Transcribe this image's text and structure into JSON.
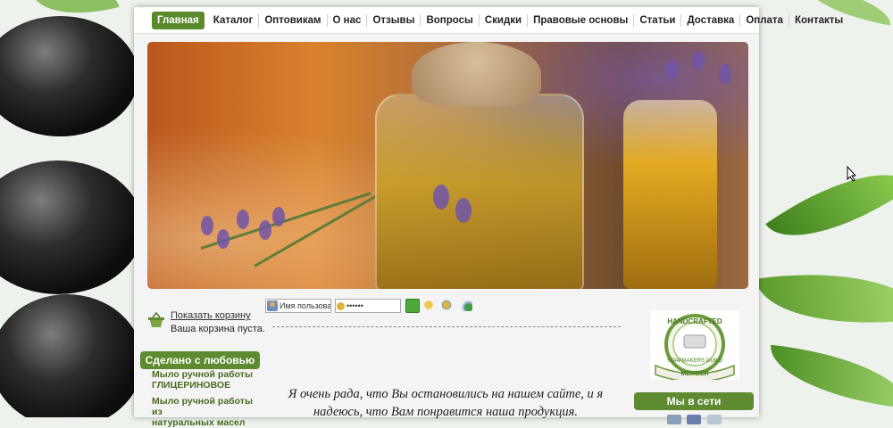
{
  "nav": {
    "items": [
      {
        "label": "Главная",
        "active": true
      },
      {
        "label": "Каталог"
      },
      {
        "label": "Оптовикам"
      },
      {
        "label": "О нас"
      },
      {
        "label": "Отзывы"
      },
      {
        "label": "Вопросы"
      },
      {
        "label": "Скидки"
      },
      {
        "label": "Правовые основы"
      },
      {
        "label": "Статьи"
      },
      {
        "label": "Доставка"
      },
      {
        "label": "Оплата"
      },
      {
        "label": "Контакты"
      }
    ],
    "accent_color": "#5b8a2c"
  },
  "cart": {
    "link": "Показать корзину",
    "status": "Ваша корзина пуста."
  },
  "sidebar": {
    "heading": "Сделано с любовью",
    "links": [
      {
        "line1": "Мыло ручной работы",
        "line2": "ГЛИЦЕРИНОВОЕ"
      },
      {
        "line1": "Мыло ручной работы из",
        "line2": "натуральных масел"
      }
    ]
  },
  "login": {
    "username_placeholder": "Имя пользователя",
    "password_value": "••••••"
  },
  "welcome": {
    "text": "Я очень  рада, что Вы остановились на нашем сайте, и я надеюсь, что Вам понравится наша продукция."
  },
  "badge": {
    "top_text": "HANDCRAFTED",
    "arc_text": "SOAPMAKERS GUILD",
    "ribbon_text": "MEMBER"
  },
  "social": {
    "heading": "Мы в сети"
  }
}
